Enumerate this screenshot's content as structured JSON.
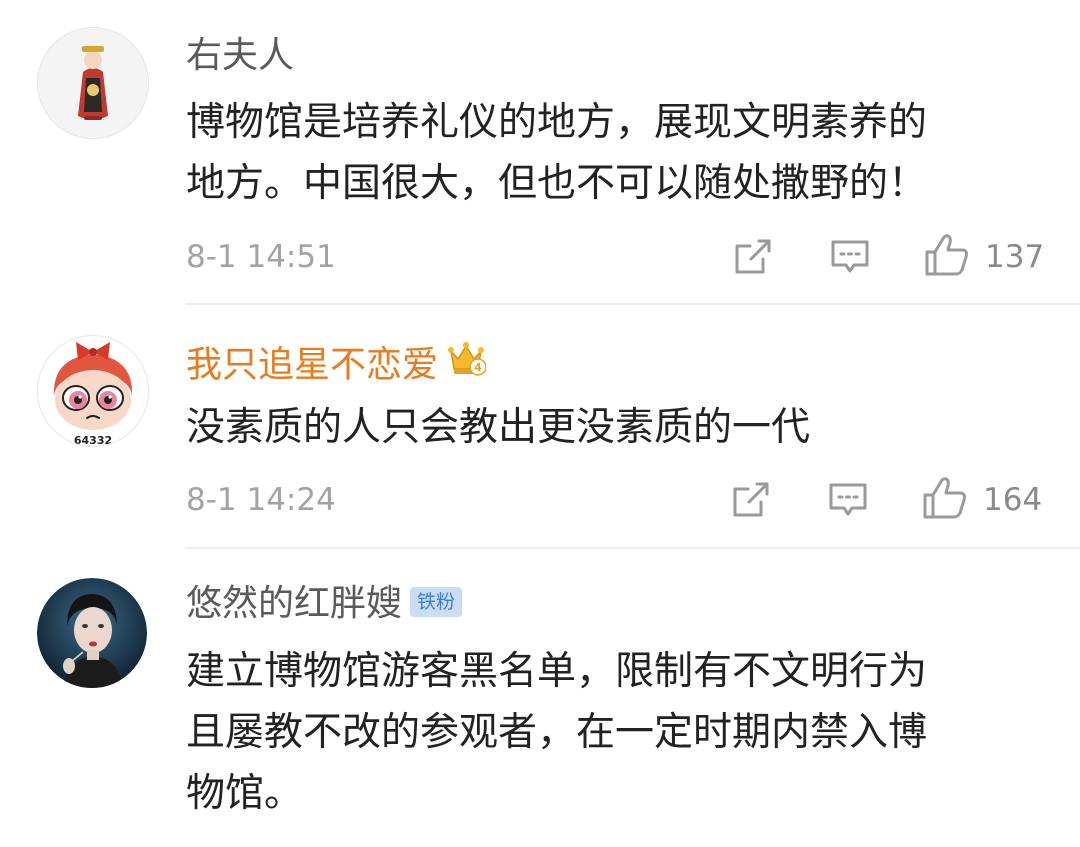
{
  "comments": [
    {
      "username": "右夫人",
      "text_lines": [
        "博物馆是培养礼仪的地方，展现文明素养的",
        "地方。中国很大，但也不可以随处撒野的！"
      ],
      "time": "8-1 14:51",
      "likes": "137"
    },
    {
      "username": "我只追星不恋爱",
      "avatar_caption": "64332",
      "crown_level": "4",
      "text_lines": [
        "没素质的人只会教出更没素质的一代"
      ],
      "time": "8-1 14:24",
      "likes": "164"
    },
    {
      "username": "悠然的红胖嫂",
      "badge": "铁粉",
      "text_lines": [
        "建立博物馆游客黑名单，限制有不文明行为",
        "且屡教不改的参观者，在一定时期内禁入博",
        "物馆。"
      ]
    }
  ],
  "icons": {
    "share": "share-icon",
    "comment": "comment-icon",
    "like": "like-icon",
    "crown": "crown-icon"
  },
  "colors": {
    "vip_name": "#ea7a1a",
    "name": "#5a5a5a",
    "text": "#222222",
    "meta": "#a3a3a3",
    "fans_badge_bg": "#c9ddf3",
    "fans_badge_text": "#3f7fcf",
    "divider": "#ececec"
  }
}
